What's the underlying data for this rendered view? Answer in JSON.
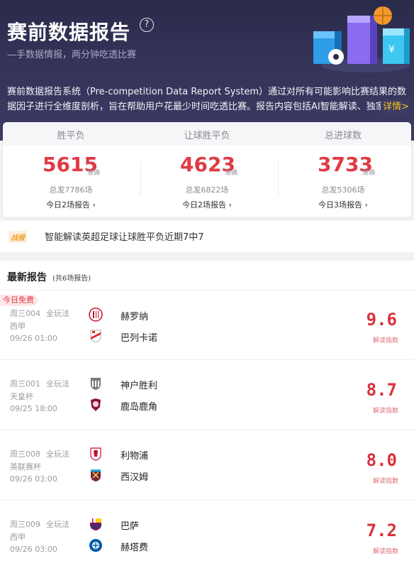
{
  "header": {
    "title": "赛前数据报告",
    "subtitle": "—手数据情报，两分钟吃透比赛",
    "description": "赛前数据报告系统（Pre-competition Data Report System）通过对所有可能影响比赛结果的数据因子进行全维度剖析，旨在帮助用户花最少时间吃透比赛。报告内容包括AI智能解读、独家临场",
    "detail_link": "详情>"
  },
  "stats": [
    {
      "label": "胜平负",
      "number": "5615",
      "unit": "准确",
      "total": "总发7786场",
      "today": "今日2场报告"
    },
    {
      "label": "让球胜平负",
      "number": "4623",
      "unit": "准确",
      "total": "总发6822场",
      "today": "今日2场报告"
    },
    {
      "label": "总进球数",
      "number": "3733",
      "unit": "准确",
      "total": "总发5306场",
      "today": "今日3场报告"
    }
  ],
  "news": {
    "tag": "战报",
    "text": "智能解读英超足球让球胜平负近期7中7"
  },
  "latest": {
    "title": "最新报告",
    "count": "(共6场报告)"
  },
  "matches": [
    {
      "badge": "今日免费",
      "code": "周三004",
      "type": "全玩法",
      "league": "西甲",
      "time": "09/26 01:00",
      "home": "赫罗纳",
      "away": "巴列卡诺",
      "score": "9.6",
      "score_label": "解读指数",
      "home_icon": "girona-crest-icon",
      "away_icon": "rayo-vallecano-crest-icon"
    },
    {
      "badge": "",
      "code": "周三001",
      "type": "全玩法",
      "league": "天皇杯",
      "time": "09/25 18:00",
      "home": "神户胜利",
      "away": "鹿岛鹿角",
      "score": "8.7",
      "score_label": "解读指数",
      "home_icon": "vissel-kobe-crest-icon",
      "away_icon": "kashima-antlers-crest-icon"
    },
    {
      "badge": "",
      "code": "周三008",
      "type": "全玩法",
      "league": "英联赛杯",
      "time": "09/26 03:00",
      "home": "利物浦",
      "away": "西汉姆",
      "score": "8.0",
      "score_label": "解读指数",
      "home_icon": "liverpool-crest-icon",
      "away_icon": "west-ham-crest-icon"
    },
    {
      "badge": "",
      "code": "周三009",
      "type": "全玩法",
      "league": "西甲",
      "time": "09/26 03:00",
      "home": "巴萨",
      "away": "赫塔费",
      "score": "7.2",
      "score_label": "解读指数",
      "home_icon": "barcelona-crest-icon",
      "away_icon": "getafe-crest-icon"
    }
  ],
  "colors": {
    "accent_red": "#e03a44",
    "header_bg": "#2a2a4a",
    "link_yellow": "#f7c51f"
  }
}
